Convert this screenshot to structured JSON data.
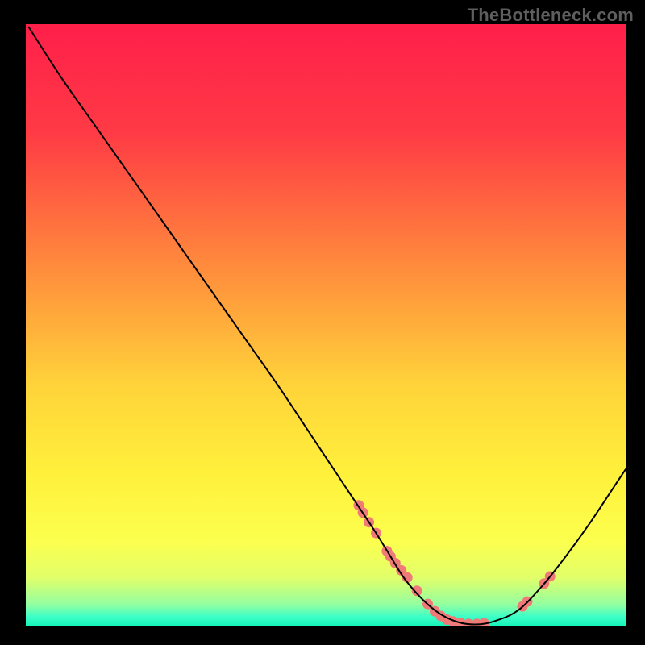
{
  "attribution": "TheBottleneck.com",
  "chart_data": {
    "type": "line",
    "title": "",
    "xlabel": "",
    "ylabel": "",
    "xlim": [
      0,
      100
    ],
    "ylim": [
      0,
      100
    ],
    "gradient_stops": [
      {
        "offset": 0.0,
        "color": "#ff1f4a"
      },
      {
        "offset": 0.18,
        "color": "#ff3a45"
      },
      {
        "offset": 0.4,
        "color": "#ff8a3c"
      },
      {
        "offset": 0.6,
        "color": "#ffd33a"
      },
      {
        "offset": 0.75,
        "color": "#fff13b"
      },
      {
        "offset": 0.86,
        "color": "#fcff4e"
      },
      {
        "offset": 0.92,
        "color": "#e1ff6a"
      },
      {
        "offset": 0.965,
        "color": "#93ffa0"
      },
      {
        "offset": 0.985,
        "color": "#3dffc8"
      },
      {
        "offset": 1.0,
        "color": "#16f5b9"
      }
    ],
    "series": [
      {
        "name": "bottleneck-curve",
        "x": [
          0.5,
          6,
          12,
          18,
          24,
          30,
          36,
          42,
          48,
          52,
          55,
          58,
          60.5,
          63,
          66,
          69,
          72,
          75,
          78,
          82,
          86,
          90,
          94,
          98,
          100
        ],
        "y": [
          99.5,
          91,
          82.5,
          74,
          65.5,
          57,
          48.5,
          40,
          31,
          25,
          20.5,
          16,
          12,
          8,
          4.5,
          2,
          0.6,
          0.2,
          0.7,
          2.5,
          6.5,
          11.5,
          17,
          23,
          26
        ]
      }
    ],
    "markers": {
      "name": "data-points",
      "x": [
        55.5,
        56.2,
        57.2,
        58.4,
        60.2,
        60.8,
        61.6,
        62.6,
        63.6,
        65.2,
        67.0,
        68.2,
        69.2,
        70.2,
        71.2,
        72.4,
        73.8,
        75.2,
        76.4,
        82.8,
        83.6,
        86.4,
        87.4
      ],
      "y": [
        20.0,
        18.8,
        17.2,
        15.4,
        12.4,
        11.5,
        10.4,
        9.2,
        8.0,
        5.8,
        3.6,
        2.4,
        1.6,
        1.0,
        0.7,
        0.5,
        0.3,
        0.3,
        0.4,
        3.2,
        4.0,
        7.0,
        8.2
      ],
      "radius": 6.5,
      "color": "#ef7a77"
    },
    "line_color": "#000000",
    "line_width": 2
  }
}
